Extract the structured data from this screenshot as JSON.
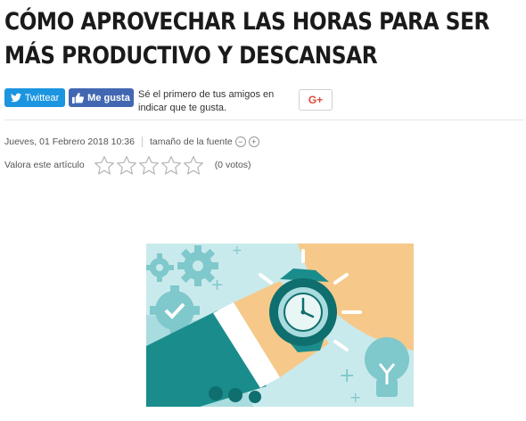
{
  "article": {
    "title": "CÓMO APROVECHAR LAS HORAS PARA SER MÁS PRODUCTIVO Y DESCANSAR",
    "date": "Jueves, 01 Febrero 2018 10:36",
    "font_size_label": "tamaño de la fuente",
    "font_decrease": "−",
    "font_increase": "+",
    "rate_label": "Valora este artículo",
    "rating_stars": 5,
    "rating_value": 0,
    "votes": "(0 votos)"
  },
  "share": {
    "twitter_label": "Twittear",
    "facebook_label": "Me gusta",
    "facebook_text": "Sé el primero de tus amigos en indicar que te gusta.",
    "gplus_label": "G+"
  },
  "colors": {
    "twitter": "#1b95e0",
    "facebook": "#4267b2",
    "gplus": "#dd4b39",
    "teal": "#1a8c8c",
    "light_teal": "#bfe3e6",
    "sand": "#f6c98a"
  },
  "icons": [
    "twitter-bird-icon",
    "thumbs-up-icon",
    "google-plus-icon",
    "star-icon",
    "gear-icon",
    "clock-icon",
    "lightbulb-icon"
  ]
}
